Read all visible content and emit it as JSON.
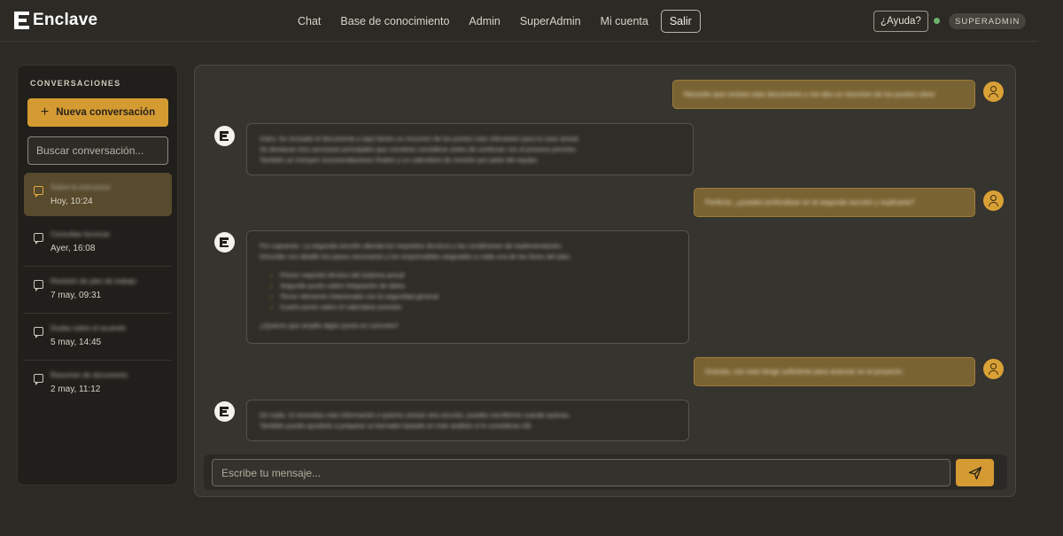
{
  "app": {
    "name": "Enclave"
  },
  "nav": {
    "links": [
      "Chat",
      "Base de conocimiento",
      "Admin",
      "SuperAdmin",
      "Mi cuenta"
    ],
    "logout": "Salir",
    "help": "¿Ayuda?",
    "role": "SUPERADMIN",
    "status_color": "#6db26a"
  },
  "sidebar": {
    "title": "CONVERSACIONES",
    "new_conversation": "Nueva conversación",
    "search_placeholder": "Buscar conversación...",
    "conversations": [
      {
        "title": "Sobre la estructura",
        "time": "Hoy, 10:24",
        "active": true
      },
      {
        "title": "Consultas tecnicas",
        "time": "Ayer, 16:08",
        "active": false
      },
      {
        "title": "Revisión de plan de trabajo",
        "time": "7 may, 09:31",
        "active": false
      },
      {
        "title": "Dudas sobre el acuerdo",
        "time": "5 may, 14:45",
        "active": false
      },
      {
        "title": "Resumen de documento",
        "time": "2 may, 11:12",
        "active": false
      }
    ]
  },
  "chat": {
    "messages": [
      {
        "role": "user",
        "text": "Necesito que revises este documento y me des un resumen de los puntos clave"
      },
      {
        "role": "bot",
        "lines": [
          "Claro, he revisado el documento y aquí tienes un resumen de los puntos más relevantes para tu caso actual.",
          "Se destacan tres secciones principales que conviene considerar antes de continuar con el proceso previsto.",
          "También se incluyen recomendaciones finales y un calendario de revisión por parte del equipo."
        ]
      },
      {
        "role": "user",
        "text": "Perfecto, ¿puedes profundizar en la segunda sección y explicarla?"
      },
      {
        "role": "bot",
        "lines": [
          "Por supuesto. La segunda sección aborda los requisitos técnicos y las condiciones de implementación.",
          "Describe con detalle los pasos necesarios y los responsables asignados a cada una de las fases del plan."
        ],
        "bullets": [
          "Primer requisito técnico del sistema actual",
          "Segundo punto sobre integración de datos",
          "Tercer elemento relacionado con la seguridad general",
          "Cuarto punto sobre el calendario previsto"
        ],
        "closing": "¿Quieres que amplíe algún punto en concreto?"
      },
      {
        "role": "user",
        "text": "Gracias, con esto tengo suficiente para avanzar en el proyecto."
      },
      {
        "role": "bot",
        "lines": [
          "De nada. Si necesitas más información o quieres revisar otra sección, puedes escribirme cuando quieras.",
          "También puedo ayudarte a preparar un borrador basado en este análisis si lo consideras útil."
        ]
      }
    ],
    "input_placeholder": "Escribe tu mensaje..."
  },
  "icons": {
    "send": "send-icon",
    "user": "user-icon",
    "bot": "enclave-logo-icon",
    "chat": "chat-bubble-icon"
  },
  "colors": {
    "accent": "#d49b33",
    "background": "#2b2a25",
    "user_bubble": "#7a6332"
  }
}
